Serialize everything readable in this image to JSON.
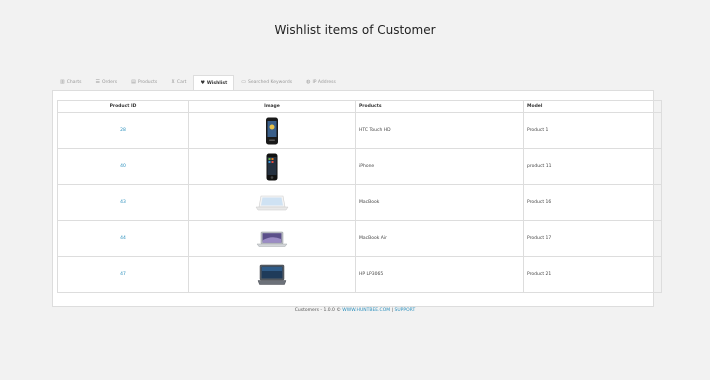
{
  "header": {
    "title": "Wishlist items of Customer"
  },
  "tabs": [
    {
      "label": "Charts",
      "icon": "chart-icon",
      "active": false
    },
    {
      "label": "Orders",
      "icon": "orders-icon",
      "active": false
    },
    {
      "label": "Products",
      "icon": "products-icon",
      "active": false
    },
    {
      "label": "Cart",
      "icon": "cart-icon",
      "active": false
    },
    {
      "label": "Wishlist",
      "icon": "heart-icon",
      "active": true
    },
    {
      "label": "Searched Keywords",
      "icon": "keyword-icon",
      "active": false
    },
    {
      "label": "IP Address",
      "icon": "globe-icon",
      "active": false
    }
  ],
  "table": {
    "headers": [
      "Product ID",
      "Image",
      "Products",
      "Model"
    ],
    "rows": [
      {
        "id": "28",
        "image": "htc-phone-image",
        "product": "HTC Touch HD",
        "model": "Product 1"
      },
      {
        "id": "40",
        "image": "iphone-image",
        "product": "iPhone",
        "model": "product 11"
      },
      {
        "id": "43",
        "image": "macbook-image",
        "product": "MacBook",
        "model": "Product 16"
      },
      {
        "id": "44",
        "image": "macbook-air-image",
        "product": "MacBook Air",
        "model": "Product 17"
      },
      {
        "id": "47",
        "image": "hp-laptop-image",
        "product": "HP LP3065",
        "model": "Product 21"
      }
    ]
  },
  "footer": {
    "text": "Customers - 1.0.0 ©",
    "brand_link": "WWW.HUNTBEE.COM",
    "separator": "|",
    "support_link": "SUPPORT"
  },
  "colors": {
    "link": "#2a8fbd",
    "background": "#f2f2f2",
    "border": "#dddddd"
  }
}
